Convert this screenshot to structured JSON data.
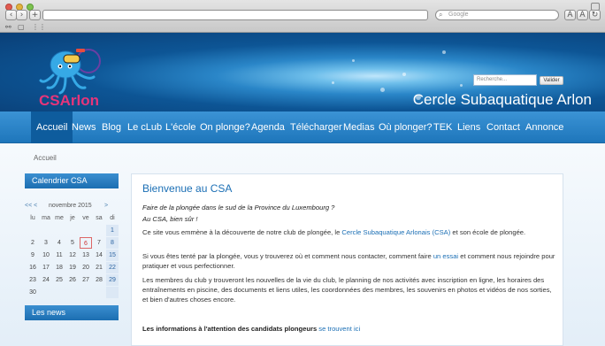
{
  "browser": {
    "search_placeholder": "Google"
  },
  "header": {
    "site_title": "Cercle Subaquatique Arlon",
    "logo_text": "CSArlon",
    "search_placeholder": "Recherche...",
    "search_button": "Valider"
  },
  "nav": {
    "items": [
      {
        "label": "Accueil",
        "active": true
      },
      {
        "label": "News"
      },
      {
        "label": "Blog"
      },
      {
        "label": "Le cLub"
      },
      {
        "label": "L'école"
      },
      {
        "label": "On plonge?"
      },
      {
        "label": "Agenda"
      },
      {
        "label": "Télécharger"
      },
      {
        "label": "Medias"
      },
      {
        "label": "Où plonger?"
      },
      {
        "label": "TEK"
      },
      {
        "label": "Liens"
      },
      {
        "label": "Contact"
      },
      {
        "label": "Annonce"
      }
    ]
  },
  "breadcrumb": "Accueil",
  "sidebar": {
    "calendar_title": "Calendrier CSA",
    "prev_arrows": "<<  <",
    "month": "novembre 2015",
    "next_arrow": ">",
    "weekdays": [
      "lu",
      "ma",
      "me",
      "je",
      "ve",
      "sa",
      "di"
    ],
    "weeks": [
      [
        "",
        "",
        "",
        "",
        "",
        "",
        "1"
      ],
      [
        "2",
        "3",
        "4",
        "5",
        "6",
        "7",
        "8"
      ],
      [
        "9",
        "10",
        "11",
        "12",
        "13",
        "14",
        "15"
      ],
      [
        "16",
        "17",
        "18",
        "19",
        "20",
        "21",
        "22"
      ],
      [
        "23",
        "24",
        "25",
        "26",
        "27",
        "28",
        "29"
      ],
      [
        "30",
        "",
        "",
        "",
        "",
        "",
        ""
      ]
    ],
    "today": "6",
    "news_title": "Les news"
  },
  "main": {
    "title": "Bienvenue au CSA",
    "question": "Faire de la plongée dans le sud de la Province du Luxembourg ?",
    "answer": "Au CSA, bien sûr !",
    "para1_a": "Ce site vous emmène à la découverte de notre club de plongée, le ",
    "para1_b": "Cercle Subaquatique Arlonais (CSA)",
    "para1_c": " et son école de plongée.",
    "para2_a": "Si vous êtes tenté par la plongée, vous y trouverez où et comment nous contacter, comment faire ",
    "para2_link": "un essai",
    "para2_b": " et comment nous rejoindre pour pratiquer et vous perfectionner.",
    "para3": "Les membres du club y trouveront les nouvelles de la vie du club, le planning de nos activités avec inscription en ligne, les horaires des entraînements en piscine, des documents et liens utiles, les coordonnées des membres, les souvenirs en photos et vidéos de nos sorties, et bien d'autres choses encore.",
    "cta_bold": "Les informations à l'attention des candidats plongeurs",
    "cta_link": "se trouvent ici"
  }
}
